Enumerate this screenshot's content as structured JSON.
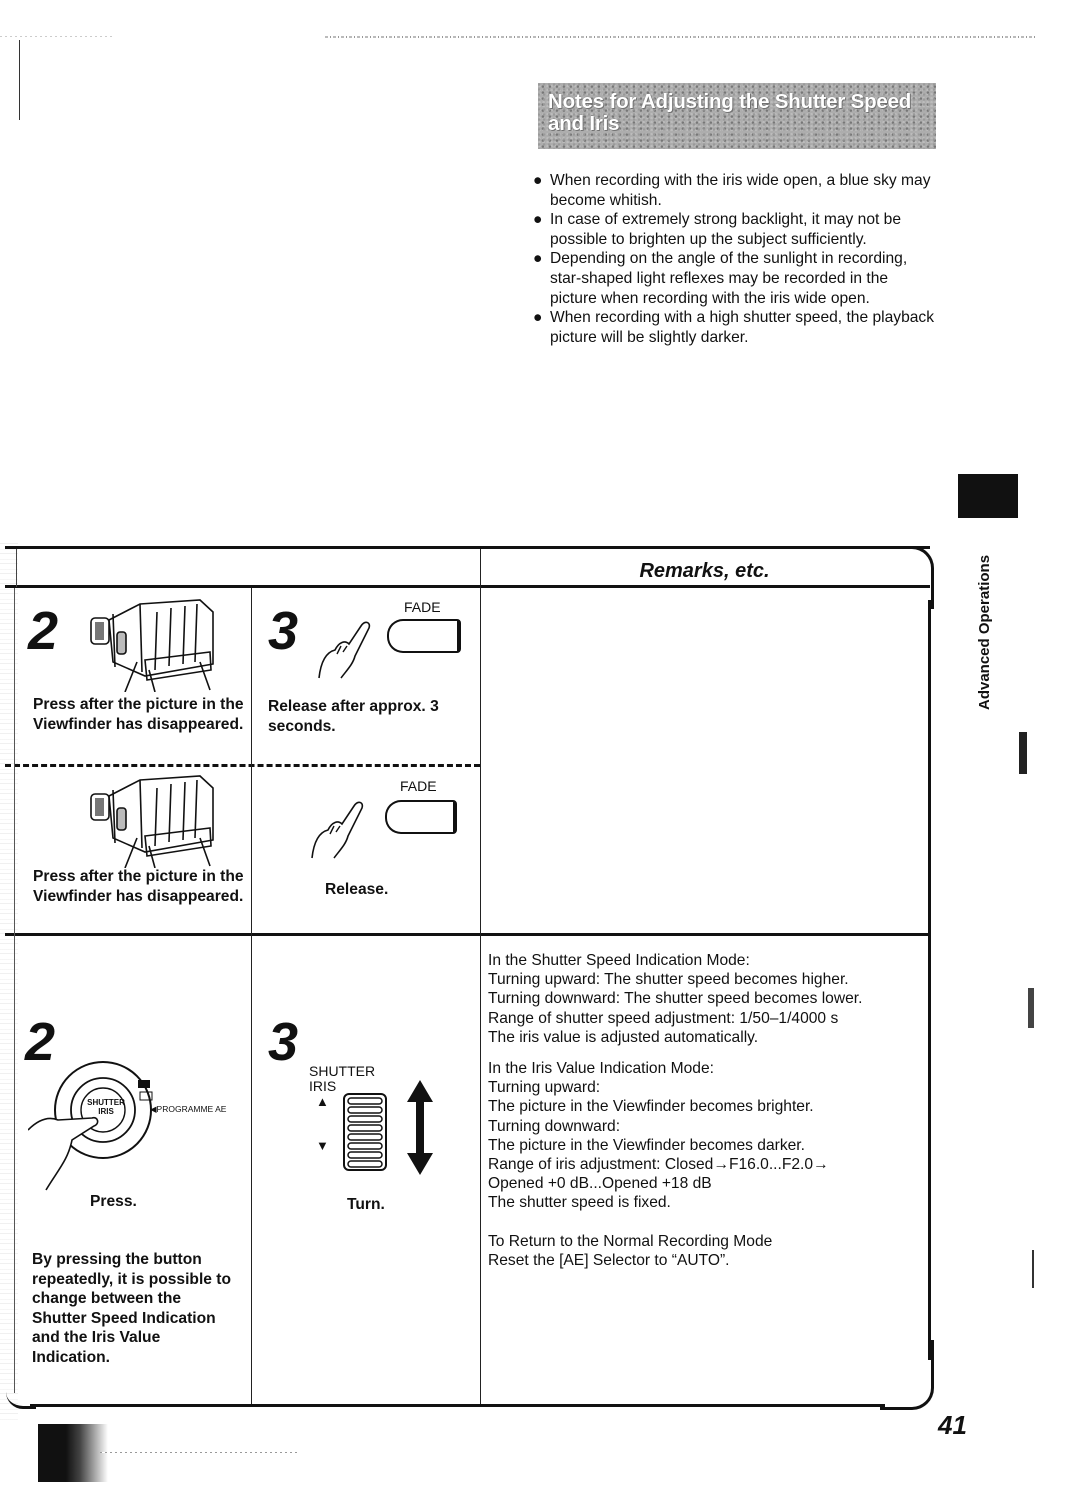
{
  "notes": {
    "title": "Notes for Adjusting the Shutter Speed and Iris",
    "bullet": "●",
    "items": [
      "When recording with the iris wide open, a blue sky may become whitish.",
      "In case of extremely strong backlight, it may not be possible to brighten up the subject sufficiently.",
      "Depending on the angle of the sunlight in recording, star-shaped light reflexes may be recorded in the picture when recording with the iris wide open.",
      "When recording with a high shutter speed, the playback picture will be slightly darker."
    ]
  },
  "side_tab": {
    "label": "Advanced Operations"
  },
  "table": {
    "remarks_header": "Remarks, etc.",
    "row1": {
      "a": {
        "step": "2",
        "text": "Press after the picture in the Viewfinder has disappeared.",
        "illustration": "camcorder-hand-illustration"
      },
      "b": {
        "step": "3",
        "button_label": "FADE",
        "text": "Release after approx. 3 seconds."
      },
      "c": {
        "text": "Press after the picture in the Viewfinder has disappeared.",
        "illustration": "camcorder-hand-illustration"
      },
      "d": {
        "button_label": "FADE",
        "text": "Release."
      }
    },
    "row2": {
      "a": {
        "step": "2",
        "dial_center_label_1": "SHUTTER",
        "dial_center_label_2": "IRIS",
        "dial_pointer_label": "◀PROGRAMME AE",
        "action": "Press.",
        "text": "By pressing the button repeatedly, it is possible to change between the Shutter Speed Indication and the Iris Value Indication."
      },
      "b": {
        "step": "3",
        "label_1": "SHUTTER",
        "label_2": "IRIS",
        "up_arrow": "▲",
        "down_arrow": "▼",
        "action": "Turn."
      },
      "remarks": [
        "In the Shutter Speed Indication Mode:",
        "Turning upward: The shutter speed becomes higher.",
        "Turning downward: The shutter speed becomes lower.",
        "Range of shutter speed adjustment: 1/50–1/4000 s",
        "The iris value is adjusted automatically.",
        "",
        "In the Iris Value Indication Mode:",
        "Turning upward:",
        "The picture in the Viewfinder becomes brighter.",
        "Turning downward:",
        "The picture in the Viewfinder becomes darker.",
        "Range of iris adjustment:  Closed→F16.0...F2.0→",
        "Opened +0 dB...Opened +18 dB",
        "The shutter speed is fixed.",
        "",
        "To Return to the Normal Recording Mode",
        "Reset the [AE] Selector to “AUTO”."
      ]
    }
  },
  "page_number": "41"
}
